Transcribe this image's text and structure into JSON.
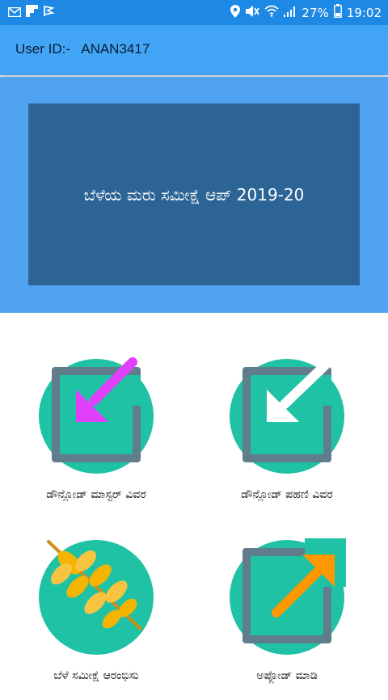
{
  "status_bar": {
    "battery": "27%",
    "time": "19:02",
    "icons": [
      "gmail-icon",
      "flipboard-icon",
      "flag-icon",
      "location-icon",
      "mute-icon",
      "wifi-icon",
      "signal-icon",
      "battery-icon"
    ]
  },
  "header": {
    "label": "User ID:-",
    "user_id": "ANAN3417",
    "text": "User ID:-   ANAN3417"
  },
  "hero": {
    "title": "ಬೆಳೆಯ ಮರು ಸಮೀಕ್ಷೆ ಆಪ್ 2019-20"
  },
  "tiles": [
    {
      "label": "ಡೌನ್ಲೋಡ್ ಮಾಸ್ಟರ್ ವಿವರ",
      "icon": "download-magenta-arrow-icon",
      "accent": "#e040fb"
    },
    {
      "label": "ಡೌನ್ಲೋಡ್ ಪಹಣಿ ವಿವರ",
      "icon": "download-white-arrow-icon",
      "accent": "#ffffff"
    },
    {
      "label": "ಬೆಳೆ ಸಮೀಕ್ಷೆ ಆರಂಭಿಸು",
      "icon": "wheat-icon",
      "accent": "#f4b400"
    },
    {
      "label": "ಅಪ್ಲೋಡ್ ಮಾಡಿ",
      "icon": "upload-arrow-icon",
      "accent": "#ff9800"
    }
  ],
  "colors": {
    "status_bar": "#1e88e5",
    "top_bar": "#42a5f5",
    "hero_bg": "#4fa3f0",
    "hero_box": "#2c6496",
    "circle": "#1fc2a4",
    "frame": "#607d8b"
  }
}
